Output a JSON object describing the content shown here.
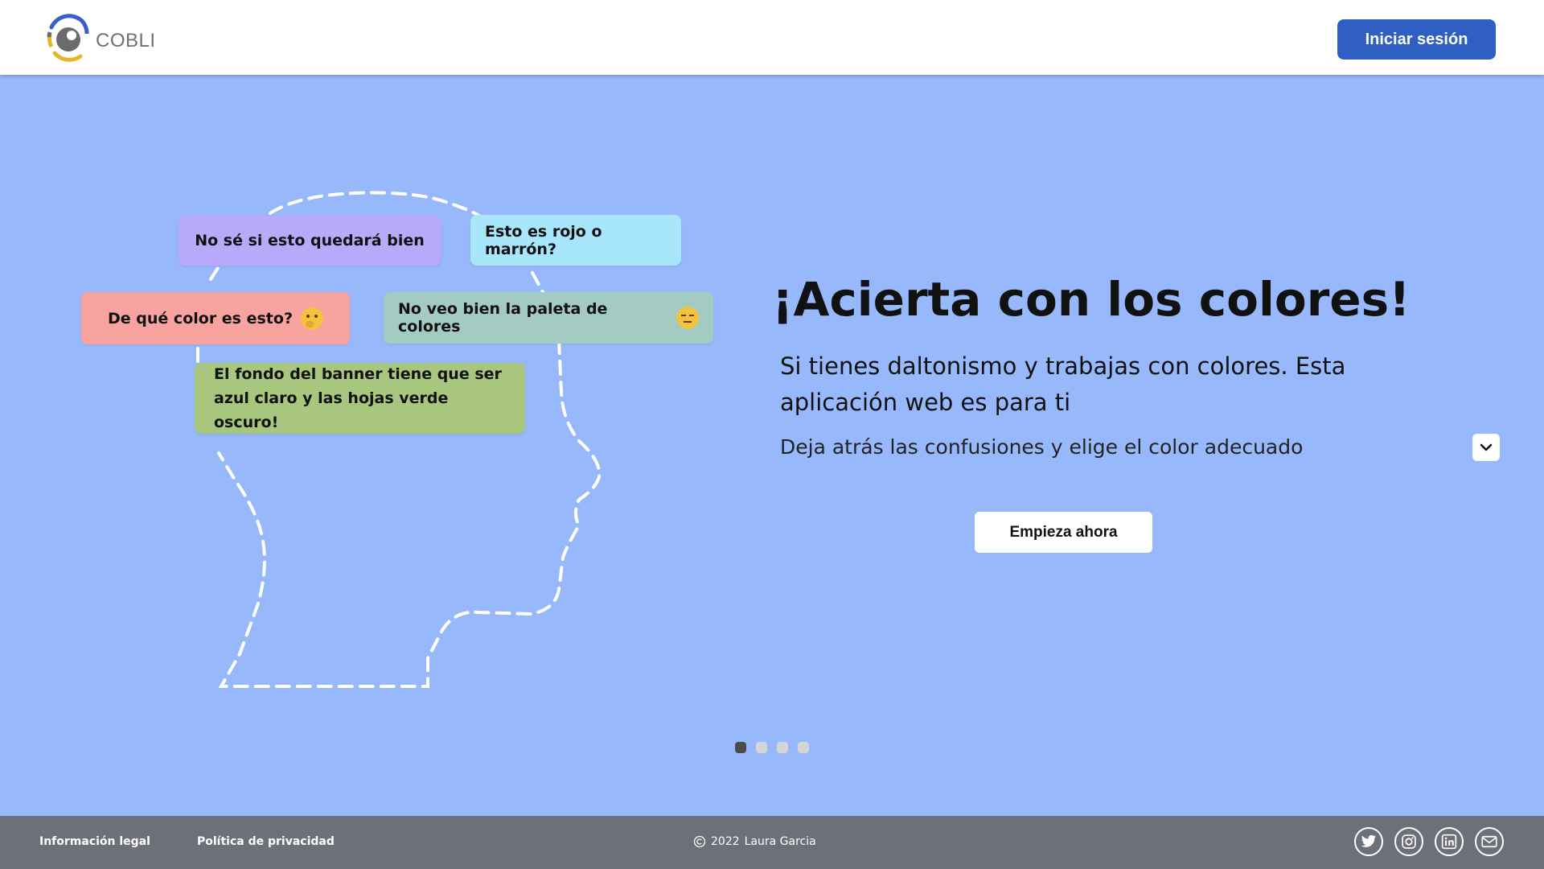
{
  "header": {
    "brand": "COBLI",
    "login_label": "Iniciar sesión",
    "logo_colors": [
      "#3b5fc9",
      "#e5b62a",
      "#6b6b6b"
    ]
  },
  "banner": {
    "bubbles": [
      {
        "text": "No sé si esto quedará bien",
        "color": "#b9a9fb"
      },
      {
        "text": "Esto es rojo o marrón?",
        "color": "#a8e6fb"
      },
      {
        "text": "De qué color es esto?",
        "color": "#f9a3a0",
        "emoji": "thinking-face-icon"
      },
      {
        "text": "No veo bien la paleta de colores",
        "color": "#a3cbc2",
        "emoji": "pensive-face-icon"
      },
      {
        "text": "El fondo del banner tiene que ser azul claro y las hojas verde oscuro!",
        "color": "#a8c67e"
      }
    ],
    "headline": "¡Acierta con los colores!",
    "subhead": "Si tienes daltonismo y trabajas con colores. Esta aplicación web es para ti",
    "description": "Deja atrás las confusiones y elige el color adecuado",
    "cta_label": "Empieza ahora",
    "slides_total": 4,
    "active_slide": 1
  },
  "footer": {
    "legal": "Información legal",
    "privacy": "Política de privacidad",
    "year": "2022",
    "author": "Laura Garcia",
    "socials": [
      "twitter-icon",
      "instagram-icon",
      "linkedin-icon",
      "mail-icon"
    ]
  },
  "colors": {
    "banner_bg": "#97b8fb",
    "header_bg": "#ffffff",
    "primary_button": "#2f5fc3",
    "footer_bg": "#6e7079"
  }
}
